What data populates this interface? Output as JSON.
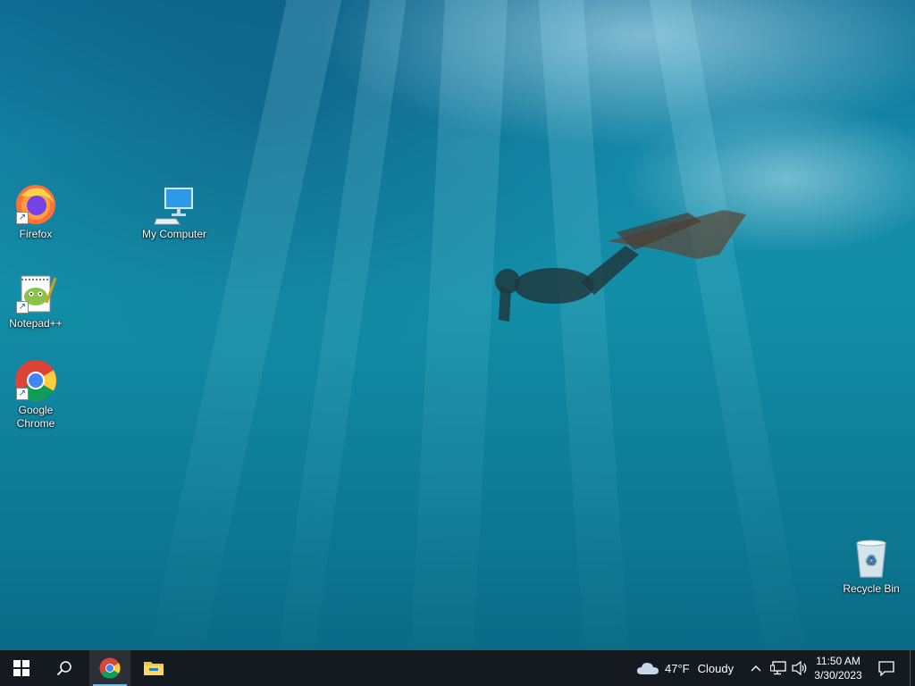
{
  "desktop": {
    "icons": [
      {
        "label": "Firefox",
        "icon": "firefox-icon"
      },
      {
        "label": "My Computer",
        "icon": "computer-icon"
      },
      {
        "label": "Notepad++",
        "icon": "notepadpp-icon"
      },
      {
        "label": "Google Chrome",
        "icon": "chrome-icon"
      },
      {
        "label": "Recycle Bin",
        "icon": "recycle-bin-icon"
      }
    ]
  },
  "taskbar": {
    "start_icon": "windows-logo-icon",
    "search_icon": "search-icon",
    "pinned": [
      {
        "name": "Google Chrome",
        "icon": "chrome-icon",
        "active": true
      },
      {
        "name": "File Explorer",
        "icon": "folder-icon",
        "active": false
      }
    ],
    "weather": {
      "temp": "47°F",
      "condition": "Cloudy",
      "icon": "cloud-icon"
    },
    "tray": {
      "chevron_icon": "chevron-up-icon",
      "network_icon": "network-icon",
      "volume_icon": "volume-icon"
    },
    "clock": {
      "time": "11:50 AM",
      "date": "3/30/2023"
    },
    "notification_icon": "notification-icon"
  },
  "colors": {
    "taskbar_bg": "#141a1f",
    "water_top": "#0f6f95",
    "water_bottom": "#0a6b86",
    "active_indicator": "#76b9ed"
  }
}
